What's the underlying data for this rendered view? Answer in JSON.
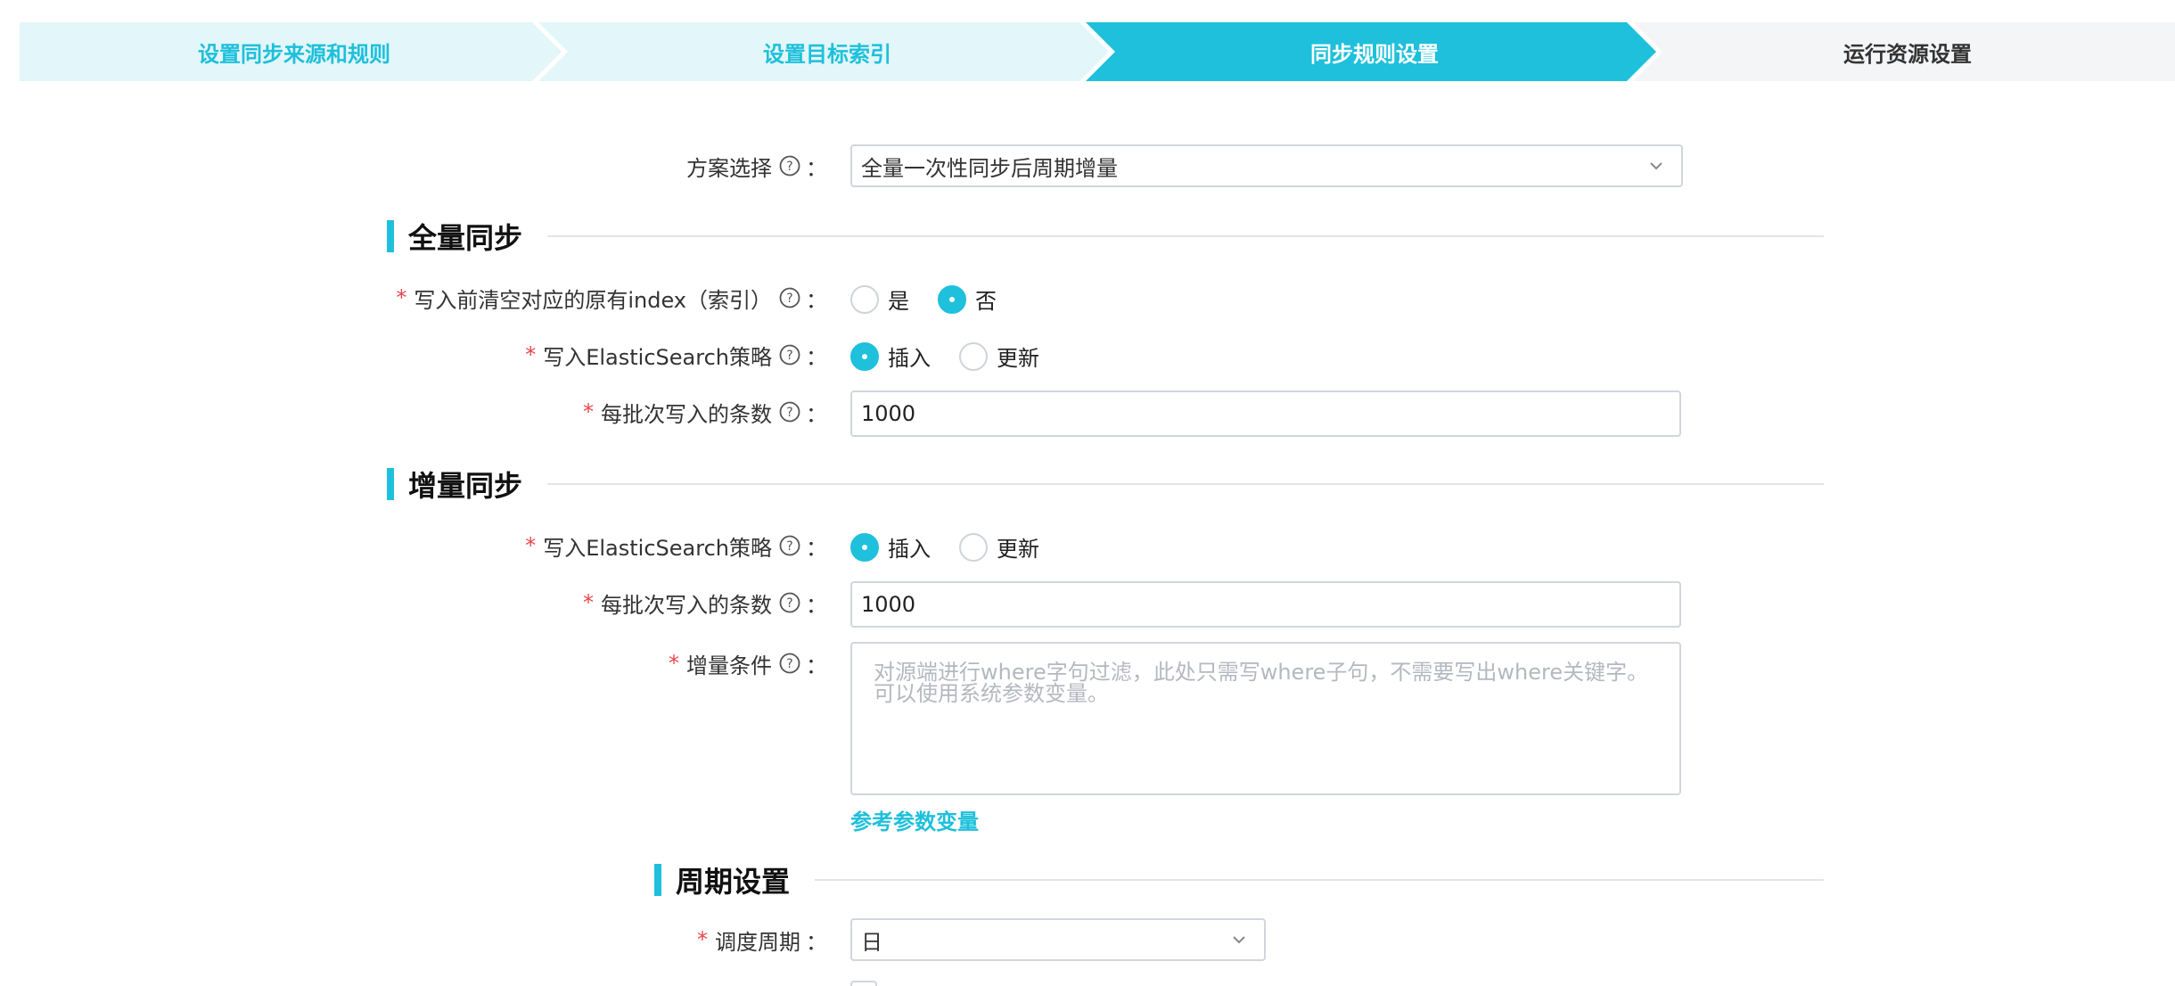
{
  "steps": [
    {
      "label": "设置同步来源和规则"
    },
    {
      "label": "设置目标索引"
    },
    {
      "label": "同步规则设置"
    },
    {
      "label": "运行资源设置"
    }
  ],
  "plan": {
    "label": "方案选择",
    "value": "全量一次性同步后周期增量"
  },
  "full_sync": {
    "title": "全量同步",
    "clear_index": {
      "label": "写入前清空对应的原有index（索引）",
      "options": [
        "是",
        "否"
      ],
      "selected": "否"
    },
    "strategy": {
      "label": "写入ElasticSearch策略",
      "options": [
        "插入",
        "更新"
      ],
      "selected": "插入"
    },
    "batch": {
      "label": "每批次写入的条数",
      "value": "1000"
    }
  },
  "incr_sync": {
    "title": "增量同步",
    "strategy": {
      "label": "写入ElasticSearch策略",
      "options": [
        "插入",
        "更新"
      ],
      "selected": "插入"
    },
    "batch": {
      "label": "每批次写入的条数",
      "value": "1000"
    },
    "condition": {
      "label": "增量条件",
      "placeholder": "对源端进行where字句过滤，此处只需写where子句，不需要写出where关键字。可以使用系统参数变量。"
    },
    "ref_link": "参考参数变量"
  },
  "period": {
    "title": "周期设置",
    "schedule": {
      "label": "调度周期",
      "value": "日"
    }
  },
  "colon": "：",
  "required_mark": "*",
  "colors": {
    "accent": "#1ec0db",
    "accent_light": "#e3f6fa",
    "required": "#e8464b"
  }
}
